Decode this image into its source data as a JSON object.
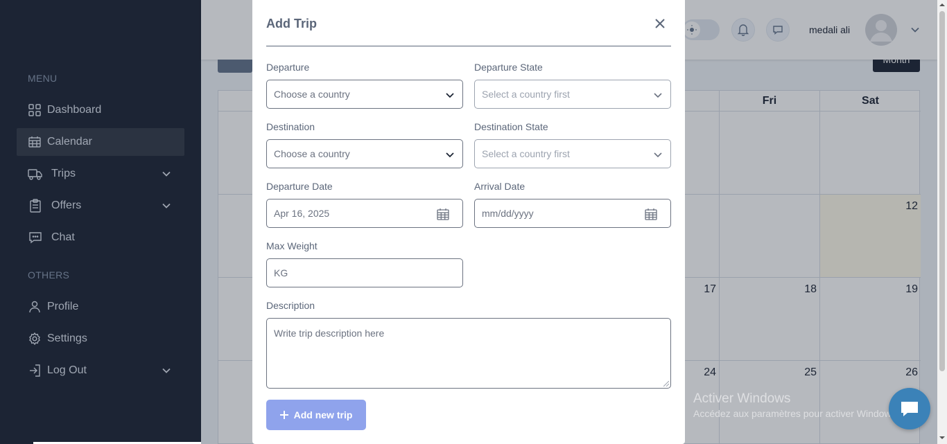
{
  "sidebar": {
    "menu_heading": "MENU",
    "others_heading": "OTHERS",
    "items": [
      {
        "label": "Dashboard",
        "icon": "grid-icon"
      },
      {
        "label": "Calendar",
        "icon": "calendar-icon",
        "active": true
      },
      {
        "label": "Trips",
        "icon": "truck-icon",
        "has_dropdown": true
      },
      {
        "label": "Offers",
        "icon": "clipboard-icon",
        "has_dropdown": true
      },
      {
        "label": "Chat",
        "icon": "chat-icon"
      },
      {
        "label": "Profile",
        "icon": "user-icon"
      },
      {
        "label": "Settings",
        "icon": "gear-icon"
      },
      {
        "label": "Log Out",
        "icon": "logout-icon",
        "has_dropdown": true
      }
    ]
  },
  "header": {
    "username": "medali ali"
  },
  "calendar": {
    "view_button": "Month",
    "day_headers": [
      "Fri",
      "Sat"
    ],
    "dates": [
      "12",
      "17",
      "18",
      "19",
      "24",
      "25",
      "26"
    ]
  },
  "modal": {
    "title": "Add Trip",
    "departure": {
      "label": "Departure",
      "value": "Choose a country"
    },
    "departure_state": {
      "label": "Departure State",
      "value": "Select a country first"
    },
    "destination": {
      "label": "Destination",
      "value": "Choose a country"
    },
    "destination_state": {
      "label": "Destination State",
      "value": "Select a country first"
    },
    "departure_date": {
      "label": "Departure Date",
      "value": "Apr 16, 2025"
    },
    "arrival_date": {
      "label": "Arrival Date",
      "value": "mm/dd/yyyy"
    },
    "max_weight": {
      "label": "Max Weight",
      "placeholder": "KG"
    },
    "description": {
      "label": "Description",
      "placeholder": "Write trip description here"
    },
    "submit_label": "Add new trip"
  },
  "watermark": {
    "line1": "Activer Windows",
    "line2": "Accédez aux paramètres pour activer Windows."
  },
  "colors": {
    "sidebar_bg": "#1c2434",
    "primary_button": "#8fa3ec",
    "today_highlight": "#fffbeb"
  }
}
